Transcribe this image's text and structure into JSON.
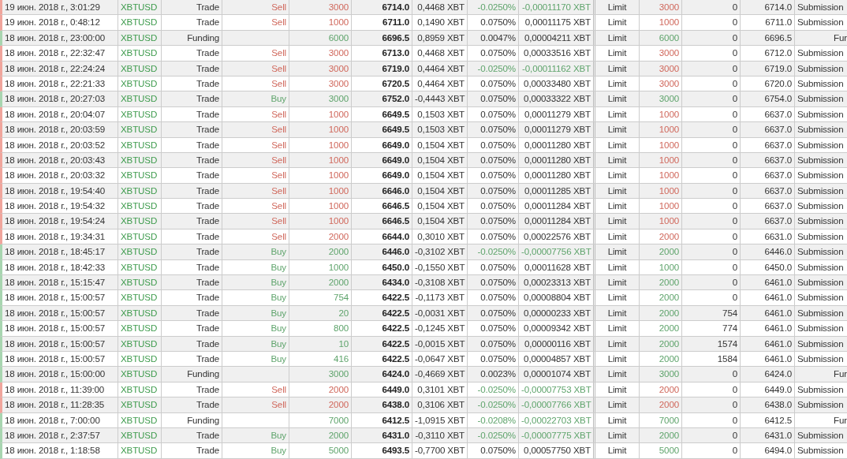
{
  "rows": [
    {
      "kind": "sell",
      "time": "19 июн. 2018 г., 3:01:29",
      "symbol": "XBTUSD",
      "type": "Trade",
      "side": "Sell",
      "qty": "3000",
      "price": "6714.0",
      "value": "0,4468 XBT",
      "fee_rate": "-0.0250%",
      "fee": "-0,00011170 XBT",
      "rebate": true,
      "order_type": "Limit",
      "order_qty": "3000",
      "leaves": "0",
      "order_price": "6714.0",
      "text": "Submission"
    },
    {
      "kind": "sell",
      "time": "19 июн. 2018 г., 0:48:12",
      "symbol": "XBTUSD",
      "type": "Trade",
      "side": "Sell",
      "qty": "1000",
      "price": "6711.0",
      "value": "0,1490 XBT",
      "fee_rate": "0.0750%",
      "fee": "0,00011175 XBT",
      "rebate": false,
      "order_type": "Limit",
      "order_qty": "1000",
      "leaves": "0",
      "order_price": "6711.0",
      "text": "Submission"
    },
    {
      "kind": "funding",
      "time": "18 июн. 2018 г., 23:00:00",
      "symbol": "XBTUSD",
      "type": "Funding",
      "qty": "6000",
      "price": "6696.5",
      "value": "0,8959 XBT",
      "fee_rate": "0.0047%",
      "fee": "0,00004211 XBT",
      "rebate": false,
      "order_type": "Limit",
      "order_qty": "6000",
      "leaves": "0",
      "order_price": "6696.5",
      "text": "Fur"
    },
    {
      "kind": "sell",
      "time": "18 июн. 2018 г., 22:32:47",
      "symbol": "XBTUSD",
      "type": "Trade",
      "side": "Sell",
      "qty": "3000",
      "price": "6713.0",
      "value": "0,4468 XBT",
      "fee_rate": "0.0750%",
      "fee": "0,00033516 XBT",
      "rebate": false,
      "order_type": "Limit",
      "order_qty": "3000",
      "leaves": "0",
      "order_price": "6712.0",
      "text": "Submission"
    },
    {
      "kind": "sell",
      "time": "18 июн. 2018 г., 22:24:24",
      "symbol": "XBTUSD",
      "type": "Trade",
      "side": "Sell",
      "qty": "3000",
      "price": "6719.0",
      "value": "0,4464 XBT",
      "fee_rate": "-0.0250%",
      "fee": "-0,00011162 XBT",
      "rebate": true,
      "order_type": "Limit",
      "order_qty": "3000",
      "leaves": "0",
      "order_price": "6719.0",
      "text": "Submission"
    },
    {
      "kind": "sell",
      "time": "18 июн. 2018 г., 22:21:33",
      "symbol": "XBTUSD",
      "type": "Trade",
      "side": "Sell",
      "qty": "3000",
      "price": "6720.5",
      "value": "0,4464 XBT",
      "fee_rate": "0.0750%",
      "fee": "0,00033480 XBT",
      "rebate": false,
      "order_type": "Limit",
      "order_qty": "3000",
      "leaves": "0",
      "order_price": "6720.0",
      "text": "Submission"
    },
    {
      "kind": "buy",
      "time": "18 июн. 2018 г., 20:27:03",
      "symbol": "XBTUSD",
      "type": "Trade",
      "side": "Buy",
      "qty": "3000",
      "price": "6752.0",
      "value": "-0,4443 XBT",
      "fee_rate": "0.0750%",
      "fee": "0,00033322 XBT",
      "rebate": false,
      "order_type": "Limit",
      "order_qty": "3000",
      "leaves": "0",
      "order_price": "6754.0",
      "text": "Submission"
    },
    {
      "kind": "sell",
      "time": "18 июн. 2018 г., 20:04:07",
      "symbol": "XBTUSD",
      "type": "Trade",
      "side": "Sell",
      "qty": "1000",
      "price": "6649.5",
      "value": "0,1503 XBT",
      "fee_rate": "0.0750%",
      "fee": "0,00011279 XBT",
      "rebate": false,
      "order_type": "Limit",
      "order_qty": "1000",
      "leaves": "0",
      "order_price": "6637.0",
      "text": "Submission"
    },
    {
      "kind": "sell",
      "time": "18 июн. 2018 г., 20:03:59",
      "symbol": "XBTUSD",
      "type": "Trade",
      "side": "Sell",
      "qty": "1000",
      "price": "6649.5",
      "value": "0,1503 XBT",
      "fee_rate": "0.0750%",
      "fee": "0,00011279 XBT",
      "rebate": false,
      "order_type": "Limit",
      "order_qty": "1000",
      "leaves": "0",
      "order_price": "6637.0",
      "text": "Submission"
    },
    {
      "kind": "sell",
      "time": "18 июн. 2018 г., 20:03:52",
      "symbol": "XBTUSD",
      "type": "Trade",
      "side": "Sell",
      "qty": "1000",
      "price": "6649.0",
      "value": "0,1504 XBT",
      "fee_rate": "0.0750%",
      "fee": "0,00011280 XBT",
      "rebate": false,
      "order_type": "Limit",
      "order_qty": "1000",
      "leaves": "0",
      "order_price": "6637.0",
      "text": "Submission"
    },
    {
      "kind": "sell",
      "time": "18 июн. 2018 г., 20:03:43",
      "symbol": "XBTUSD",
      "type": "Trade",
      "side": "Sell",
      "qty": "1000",
      "price": "6649.0",
      "value": "0,1504 XBT",
      "fee_rate": "0.0750%",
      "fee": "0,00011280 XBT",
      "rebate": false,
      "order_type": "Limit",
      "order_qty": "1000",
      "leaves": "0",
      "order_price": "6637.0",
      "text": "Submission"
    },
    {
      "kind": "sell",
      "time": "18 июн. 2018 г., 20:03:32",
      "symbol": "XBTUSD",
      "type": "Trade",
      "side": "Sell",
      "qty": "1000",
      "price": "6649.0",
      "value": "0,1504 XBT",
      "fee_rate": "0.0750%",
      "fee": "0,00011280 XBT",
      "rebate": false,
      "order_type": "Limit",
      "order_qty": "1000",
      "leaves": "0",
      "order_price": "6637.0",
      "text": "Submission"
    },
    {
      "kind": "sell",
      "time": "18 июн. 2018 г., 19:54:40",
      "symbol": "XBTUSD",
      "type": "Trade",
      "side": "Sell",
      "qty": "1000",
      "price": "6646.0",
      "value": "0,1504 XBT",
      "fee_rate": "0.0750%",
      "fee": "0,00011285 XBT",
      "rebate": false,
      "order_type": "Limit",
      "order_qty": "1000",
      "leaves": "0",
      "order_price": "6637.0",
      "text": "Submission"
    },
    {
      "kind": "sell",
      "time": "18 июн. 2018 г., 19:54:32",
      "symbol": "XBTUSD",
      "type": "Trade",
      "side": "Sell",
      "qty": "1000",
      "price": "6646.5",
      "value": "0,1504 XBT",
      "fee_rate": "0.0750%",
      "fee": "0,00011284 XBT",
      "rebate": false,
      "order_type": "Limit",
      "order_qty": "1000",
      "leaves": "0",
      "order_price": "6637.0",
      "text": "Submission"
    },
    {
      "kind": "sell",
      "time": "18 июн. 2018 г., 19:54:24",
      "symbol": "XBTUSD",
      "type": "Trade",
      "side": "Sell",
      "qty": "1000",
      "price": "6646.5",
      "value": "0,1504 XBT",
      "fee_rate": "0.0750%",
      "fee": "0,00011284 XBT",
      "rebate": false,
      "order_type": "Limit",
      "order_qty": "1000",
      "leaves": "0",
      "order_price": "6637.0",
      "text": "Submission"
    },
    {
      "kind": "sell",
      "time": "18 июн. 2018 г., 19:34:31",
      "symbol": "XBTUSD",
      "type": "Trade",
      "side": "Sell",
      "qty": "2000",
      "price": "6644.0",
      "value": "0,3010 XBT",
      "fee_rate": "0.0750%",
      "fee": "0,00022576 XBT",
      "rebate": false,
      "order_type": "Limit",
      "order_qty": "2000",
      "leaves": "0",
      "order_price": "6631.0",
      "text": "Submission"
    },
    {
      "kind": "buy",
      "time": "18 июн. 2018 г., 18:45:17",
      "symbol": "XBTUSD",
      "type": "Trade",
      "side": "Buy",
      "qty": "2000",
      "price": "6446.0",
      "value": "-0,3102 XBT",
      "fee_rate": "-0.0250%",
      "fee": "-0,00007756 XBT",
      "rebate": true,
      "order_type": "Limit",
      "order_qty": "2000",
      "leaves": "0",
      "order_price": "6446.0",
      "text": "Submission"
    },
    {
      "kind": "buy",
      "time": "18 июн. 2018 г., 18:42:33",
      "symbol": "XBTUSD",
      "type": "Trade",
      "side": "Buy",
      "qty": "1000",
      "price": "6450.0",
      "value": "-0,1550 XBT",
      "fee_rate": "0.0750%",
      "fee": "0,00011628 XBT",
      "rebate": false,
      "order_type": "Limit",
      "order_qty": "1000",
      "leaves": "0",
      "order_price": "6450.0",
      "text": "Submission"
    },
    {
      "kind": "buy",
      "time": "18 июн. 2018 г., 15:15:47",
      "symbol": "XBTUSD",
      "type": "Trade",
      "side": "Buy",
      "qty": "2000",
      "price": "6434.0",
      "value": "-0,3108 XBT",
      "fee_rate": "0.0750%",
      "fee": "0,00023313 XBT",
      "rebate": false,
      "order_type": "Limit",
      "order_qty": "2000",
      "leaves": "0",
      "order_price": "6461.0",
      "text": "Submission"
    },
    {
      "kind": "buy",
      "time": "18 июн. 2018 г., 15:00:57",
      "symbol": "XBTUSD",
      "type": "Trade",
      "side": "Buy",
      "qty": "754",
      "price": "6422.5",
      "value": "-0,1173 XBT",
      "fee_rate": "0.0750%",
      "fee": "0,00008804 XBT",
      "rebate": false,
      "order_type": "Limit",
      "order_qty": "2000",
      "leaves": "0",
      "order_price": "6461.0",
      "text": "Submission"
    },
    {
      "kind": "buy",
      "time": "18 июн. 2018 г., 15:00:57",
      "symbol": "XBTUSD",
      "type": "Trade",
      "side": "Buy",
      "qty": "20",
      "price": "6422.5",
      "value": "-0,0031 XBT",
      "fee_rate": "0.0750%",
      "fee": "0,00000233 XBT",
      "rebate": false,
      "order_type": "Limit",
      "order_qty": "2000",
      "leaves": "754",
      "order_price": "6461.0",
      "text": "Submission"
    },
    {
      "kind": "buy",
      "time": "18 июн. 2018 г., 15:00:57",
      "symbol": "XBTUSD",
      "type": "Trade",
      "side": "Buy",
      "qty": "800",
      "price": "6422.5",
      "value": "-0,1245 XBT",
      "fee_rate": "0.0750%",
      "fee": "0,00009342 XBT",
      "rebate": false,
      "order_type": "Limit",
      "order_qty": "2000",
      "leaves": "774",
      "order_price": "6461.0",
      "text": "Submission"
    },
    {
      "kind": "buy",
      "time": "18 июн. 2018 г., 15:00:57",
      "symbol": "XBTUSD",
      "type": "Trade",
      "side": "Buy",
      "qty": "10",
      "price": "6422.5",
      "value": "-0,0015 XBT",
      "fee_rate": "0.0750%",
      "fee": "0,00000116 XBT",
      "rebate": false,
      "order_type": "Limit",
      "order_qty": "2000",
      "leaves": "1574",
      "order_price": "6461.0",
      "text": "Submission"
    },
    {
      "kind": "buy",
      "time": "18 июн. 2018 г., 15:00:57",
      "symbol": "XBTUSD",
      "type": "Trade",
      "side": "Buy",
      "qty": "416",
      "price": "6422.5",
      "value": "-0,0647 XBT",
      "fee_rate": "0.0750%",
      "fee": "0,00004857 XBT",
      "rebate": false,
      "order_type": "Limit",
      "order_qty": "2000",
      "leaves": "1584",
      "order_price": "6461.0",
      "text": "Submission"
    },
    {
      "kind": "funding",
      "time": "18 июн. 2018 г., 15:00:00",
      "symbol": "XBTUSD",
      "type": "Funding",
      "qty": "3000",
      "price": "6424.0",
      "value": "-0,4669 XBT",
      "fee_rate": "0.0023%",
      "fee": "0,00001074 XBT",
      "rebate": false,
      "order_type": "Limit",
      "order_qty": "3000",
      "leaves": "0",
      "order_price": "6424.0",
      "text": "Fur"
    },
    {
      "kind": "sell",
      "time": "18 июн. 2018 г., 11:39:00",
      "symbol": "XBTUSD",
      "type": "Trade",
      "side": "Sell",
      "qty": "2000",
      "price": "6449.0",
      "value": "0,3101 XBT",
      "fee_rate": "-0.0250%",
      "fee": "-0,00007753 XBT",
      "rebate": true,
      "order_type": "Limit",
      "order_qty": "2000",
      "leaves": "0",
      "order_price": "6449.0",
      "text": "Submission"
    },
    {
      "kind": "sell",
      "time": "18 июн. 2018 г., 11:28:35",
      "symbol": "XBTUSD",
      "type": "Trade",
      "side": "Sell",
      "qty": "2000",
      "price": "6438.0",
      "value": "0,3106 XBT",
      "fee_rate": "-0.0250%",
      "fee": "-0,00007766 XBT",
      "rebate": true,
      "order_type": "Limit",
      "order_qty": "2000",
      "leaves": "0",
      "order_price": "6438.0",
      "text": "Submission"
    },
    {
      "kind": "funding",
      "time": "18 июн. 2018 г., 7:00:00",
      "symbol": "XBTUSD",
      "type": "Funding",
      "qty": "7000",
      "price": "6412.5",
      "value": "-1,0915 XBT",
      "fee_rate": "-0.0208%",
      "fee": "-0,00022703 XBT",
      "rebate": true,
      "order_type": "Limit",
      "order_qty": "7000",
      "leaves": "0",
      "order_price": "6412.5",
      "text": "Fur"
    },
    {
      "kind": "buy",
      "time": "18 июн. 2018 г., 2:37:57",
      "symbol": "XBTUSD",
      "type": "Trade",
      "side": "Buy",
      "qty": "2000",
      "price": "6431.0",
      "value": "-0,3110 XBT",
      "fee_rate": "-0.0250%",
      "fee": "-0,00007775 XBT",
      "rebate": true,
      "order_type": "Limit",
      "order_qty": "2000",
      "leaves": "0",
      "order_price": "6431.0",
      "text": "Submission"
    },
    {
      "kind": "buy",
      "time": "18 июн. 2018 г., 1:18:58",
      "symbol": "XBTUSD",
      "type": "Trade",
      "side": "Buy",
      "qty": "5000",
      "price": "6493.5",
      "value": "-0,7700 XBT",
      "fee_rate": "0.0750%",
      "fee": "0,00057750 XBT",
      "rebate": false,
      "order_type": "Limit",
      "order_qty": "5000",
      "leaves": "0",
      "order_price": "6494.0",
      "text": "Submission"
    }
  ]
}
